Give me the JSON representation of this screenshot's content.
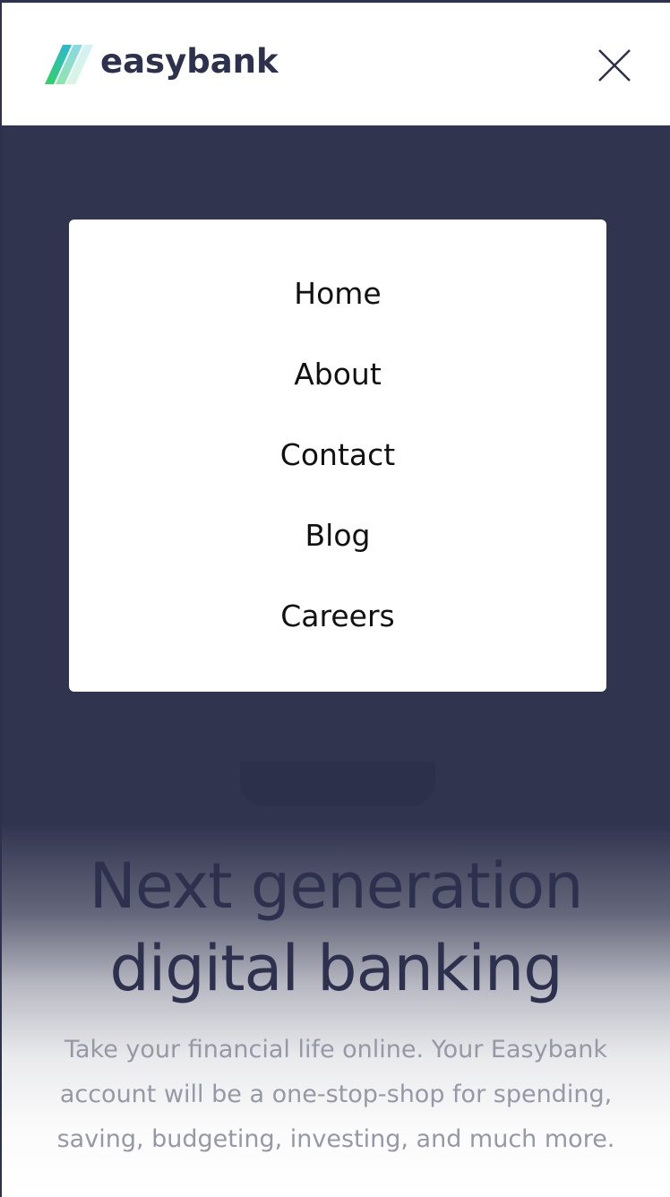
{
  "brand": {
    "name": "easybank",
    "text_color": "#2d314d",
    "gradient": [
      "#33d35e",
      "#2ab6d9"
    ]
  },
  "header": {
    "close_icon": "close-icon"
  },
  "menu": {
    "items": [
      {
        "label": "Home"
      },
      {
        "label": "About"
      },
      {
        "label": "Contact"
      },
      {
        "label": "Blog"
      },
      {
        "label": "Careers"
      }
    ]
  },
  "hero": {
    "title_line1": "Next generation",
    "title_line2": "digital banking",
    "description": "Take your financial life online. Your Easybank account will be a one-stop-shop for spending, saving, budgeting, investing, and much more."
  },
  "colors": {
    "overlay": "#31344f",
    "text_primary": "#2d314d",
    "text_muted": "#9698a6",
    "card": "#ffffff"
  }
}
